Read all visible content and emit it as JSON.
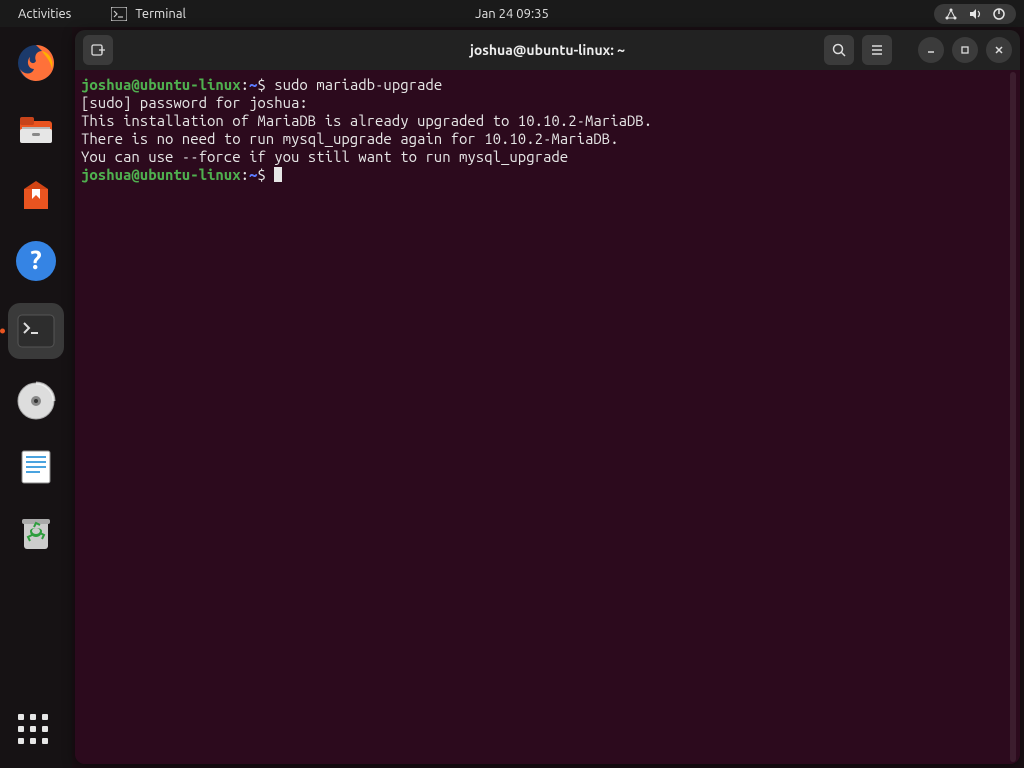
{
  "topbar": {
    "activities": "Activities",
    "active_app": "Terminal",
    "clock": "Jan 24  09:35"
  },
  "window": {
    "title": "joshua@ubuntu-linux: ~"
  },
  "terminal": {
    "prompt1": {
      "user": "joshua@ubuntu-linux",
      "path": "~",
      "command": "sudo mariadb-upgrade"
    },
    "lines": {
      "l1": "[sudo] password for joshua:",
      "l2": "This installation of MariaDB is already upgraded to 10.10.2-MariaDB.",
      "l3": "There is no need to run mysql_upgrade again for 10.10.2-MariaDB.",
      "l4": "You can use --force if you still want to run mysql_upgrade"
    },
    "prompt2": {
      "user": "joshua@ubuntu-linux",
      "path": "~"
    }
  },
  "dock": {
    "items": [
      {
        "name": "firefox"
      },
      {
        "name": "files"
      },
      {
        "name": "software"
      },
      {
        "name": "help"
      },
      {
        "name": "terminal",
        "active": true
      },
      {
        "name": "disk"
      },
      {
        "name": "text-editor"
      },
      {
        "name": "trash"
      }
    ]
  }
}
